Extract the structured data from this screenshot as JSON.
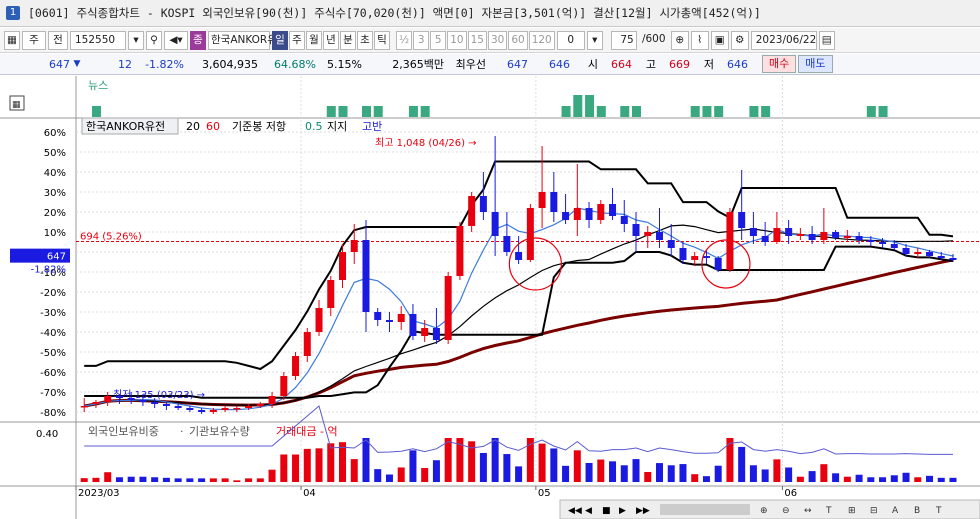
{
  "window": {
    "title": "[0601] 주식종합차트 - KOSPI 외국인보유[90(천)] 주식수[70,020(천)] 액면[0] 자본금[3,501(억)] 결산[12월] 시가총액[452(억)]",
    "icon": "1"
  },
  "toolbar": {
    "period_select": "주",
    "chart_type": "전",
    "code": "152550",
    "stock_name": "한국ANKOR유",
    "mode_badge": "종",
    "period_tabs": [
      "일",
      "주",
      "월",
      "년",
      "분",
      "초",
      "틱"
    ],
    "period_selected": "일",
    "intervals": [
      "½",
      "3",
      "5",
      "10",
      "15",
      "30",
      "60",
      "120"
    ],
    "interval_value": "0",
    "view_count": "75",
    "view_total": "/600",
    "date": "2023/06/22"
  },
  "quote": {
    "price": "647",
    "change": "12",
    "change_pct": "-1.82%",
    "volume": "3,604,935",
    "vol_ratio": "64.68%",
    "turnover": "5.15%",
    "amount": "2,365백만",
    "priority_label": "최우선",
    "bid": "647",
    "ask": "646",
    "open_label": "시",
    "open": "664",
    "high_label": "고",
    "high": "669",
    "low_label": "저",
    "low": "646",
    "buy_button": "매수",
    "sell_button": "매도"
  },
  "news_panel": {
    "label": "뉴스",
    "bars": [
      0,
      1,
      0,
      0,
      0,
      0,
      0,
      0,
      0,
      0,
      0,
      0,
      0,
      0,
      0,
      0,
      0,
      0,
      0,
      0,
      0,
      1,
      1,
      0,
      1,
      1,
      0,
      0,
      1,
      1,
      0,
      0,
      0,
      0,
      0,
      0,
      0,
      0,
      0,
      0,
      0,
      1,
      2,
      2,
      1,
      0,
      1,
      1,
      0,
      0,
      0,
      0,
      1,
      1,
      1,
      0,
      0,
      1,
      1,
      0,
      0,
      0,
      0,
      0,
      0,
      0,
      0,
      1,
      1,
      0,
      0,
      0,
      0,
      0,
      0
    ]
  },
  "main_legend": {
    "name": "한국ANKOR유전",
    "ma1": "20",
    "ma2": "60",
    "ind_label": "기준봉 저항",
    "ind_val": "0.5",
    "support": "지지",
    "resistance": "고반"
  },
  "axis_y": [
    "60%",
    "50%",
    "40%",
    "30%",
    "20%",
    "10%",
    "0%",
    "-10%",
    "-20%",
    "-30%",
    "-40%",
    "-50%",
    "-60%",
    "-70%",
    "-80%"
  ],
  "price_tag": {
    "price": "647",
    "pct": "-1.82%"
  },
  "ref_line": {
    "label": "694 (5.26%)",
    "value": 5.26
  },
  "annotations": {
    "high": "최고 1,048 (04/26)",
    "low": "최저 135 (03/23)"
  },
  "chart_data": {
    "type": "candlestick",
    "y_unit": "%",
    "ylim": [
      -82,
      66
    ],
    "candles": [
      {
        "o": -77,
        "h": -73,
        "l": -80,
        "c": -77
      },
      {
        "o": -76,
        "h": -74,
        "l": -78,
        "c": -75
      },
      {
        "o": -75,
        "h": -70,
        "l": -77,
        "c": -72
      },
      {
        "o": -72,
        "h": -71,
        "l": -76,
        "c": -73
      },
      {
        "o": -73,
        "h": -70,
        "l": -76,
        "c": -74
      },
      {
        "o": -74,
        "h": -71,
        "l": -77,
        "c": -75
      },
      {
        "o": -75,
        "h": -73,
        "l": -78,
        "c": -76
      },
      {
        "o": -76,
        "h": -75,
        "l": -79,
        "c": -77
      },
      {
        "o": -77,
        "h": -76,
        "l": -79,
        "c": -78
      },
      {
        "o": -78,
        "h": -77,
        "l": -80,
        "c": -79
      },
      {
        "o": -79,
        "h": -78,
        "l": -81,
        "c": -80
      },
      {
        "o": -80,
        "h": -78,
        "l": -81,
        "c": -79
      },
      {
        "o": -79,
        "h": -77,
        "l": -80,
        "c": -78
      },
      {
        "o": -78,
        "h": -77,
        "l": -80,
        "c": -78
      },
      {
        "o": -78,
        "h": -76,
        "l": -79,
        "c": -77
      },
      {
        "o": -77,
        "h": -75,
        "l": -78,
        "c": -76
      },
      {
        "o": -76,
        "h": -70,
        "l": -78,
        "c": -72
      },
      {
        "o": -72,
        "h": -60,
        "l": -74,
        "c": -62
      },
      {
        "o": -62,
        "h": -50,
        "l": -64,
        "c": -52
      },
      {
        "o": -52,
        "h": -38,
        "l": -55,
        "c": -40
      },
      {
        "o": -40,
        "h": -24,
        "l": -42,
        "c": -28
      },
      {
        "o": -28,
        "h": -12,
        "l": -32,
        "c": -14
      },
      {
        "o": -14,
        "h": 4,
        "l": -18,
        "c": 0
      },
      {
        "o": 0,
        "h": 14,
        "l": -6,
        "c": 6
      },
      {
        "o": 6,
        "h": 16,
        "l": -40,
        "c": -30
      },
      {
        "o": -30,
        "h": -28,
        "l": -37,
        "c": -34
      },
      {
        "o": -34,
        "h": -30,
        "l": -40,
        "c": -35
      },
      {
        "o": -35,
        "h": -27,
        "l": -39,
        "c": -31
      },
      {
        "o": -31,
        "h": -26,
        "l": -44,
        "c": -42
      },
      {
        "o": -42,
        "h": -34,
        "l": -45,
        "c": -38
      },
      {
        "o": -38,
        "h": -28,
        "l": -46,
        "c": -44
      },
      {
        "o": -44,
        "h": -10,
        "l": -46,
        "c": -12
      },
      {
        "o": -12,
        "h": 15,
        "l": -14,
        "c": 13
      },
      {
        "o": 13,
        "h": 30,
        "l": 10,
        "c": 28
      },
      {
        "o": 28,
        "h": 40,
        "l": 16,
        "c": 20
      },
      {
        "o": 20,
        "h": 58,
        "l": -2,
        "c": 8
      },
      {
        "o": 8,
        "h": 20,
        "l": -2,
        "c": 0
      },
      {
        "o": 0,
        "h": 8,
        "l": -6,
        "c": -4
      },
      {
        "o": -4,
        "h": 24,
        "l": -5,
        "c": 22
      },
      {
        "o": 22,
        "h": 53,
        "l": 12,
        "c": 30
      },
      {
        "o": 30,
        "h": 40,
        "l": 15,
        "c": 20
      },
      {
        "o": 20,
        "h": 29,
        "l": 14,
        "c": 16
      },
      {
        "o": 16,
        "h": 44,
        "l": 8,
        "c": 22
      },
      {
        "o": 22,
        "h": 25,
        "l": 12,
        "c": 16
      },
      {
        "o": 16,
        "h": 26,
        "l": 14,
        "c": 24
      },
      {
        "o": 24,
        "h": 32,
        "l": 16,
        "c": 18
      },
      {
        "o": 18,
        "h": 26,
        "l": 10,
        "c": 14
      },
      {
        "o": 14,
        "h": 20,
        "l": 0,
        "c": 8
      },
      {
        "o": 8,
        "h": 13,
        "l": 2,
        "c": 10
      },
      {
        "o": 10,
        "h": 22,
        "l": 2,
        "c": 6
      },
      {
        "o": 6,
        "h": 14,
        "l": -2,
        "c": 2
      },
      {
        "o": 2,
        "h": 5,
        "l": -6,
        "c": -4
      },
      {
        "o": -4,
        "h": 0,
        "l": -7,
        "c": -2
      },
      {
        "o": -2,
        "h": 1,
        "l": -6,
        "c": -3
      },
      {
        "o": -3,
        "h": -2,
        "l": -10,
        "c": -9
      },
      {
        "o": -9,
        "h": 22,
        "l": -10,
        "c": 20
      },
      {
        "o": 20,
        "h": 41,
        "l": 6,
        "c": 12
      },
      {
        "o": 12,
        "h": 20,
        "l": 4,
        "c": 8
      },
      {
        "o": 8,
        "h": 15,
        "l": 3,
        "c": 5
      },
      {
        "o": 5,
        "h": 20,
        "l": 4,
        "c": 12
      },
      {
        "o": 12,
        "h": 16,
        "l": 4,
        "c": 8
      },
      {
        "o": 8,
        "h": 12,
        "l": 6,
        "c": 9
      },
      {
        "o": 9,
        "h": 13,
        "l": 4,
        "c": 6
      },
      {
        "o": 6,
        "h": 22,
        "l": 4,
        "c": 10
      },
      {
        "o": 10,
        "h": 11,
        "l": 6,
        "c": 7
      },
      {
        "o": 7,
        "h": 11,
        "l": 5,
        "c": 8
      },
      {
        "o": 8,
        "h": 10,
        "l": 4,
        "c": 6
      },
      {
        "o": 6,
        "h": 8,
        "l": 3,
        "c": 5
      },
      {
        "o": 5,
        "h": 7,
        "l": 2,
        "c": 4
      },
      {
        "o": 4,
        "h": 6,
        "l": 1,
        "c": 2
      },
      {
        "o": 2,
        "h": 4,
        "l": -2,
        "c": -1
      },
      {
        "o": -1,
        "h": 2,
        "l": -3,
        "c": 0
      },
      {
        "o": 0,
        "h": 1,
        "l": -3,
        "c": -2
      },
      {
        "o": -2,
        "h": 0,
        "l": -4,
        "c": -3
      },
      {
        "o": -3,
        "h": -1,
        "l": -5,
        "c": -4
      }
    ]
  },
  "volume_panel": {
    "label1": "외국인보유비중",
    "sep": "·",
    "label2": "기관보유수량",
    "label3": "거래대금 - 억",
    "axis_label": "0.40"
  },
  "x_labels": [
    "2023/03",
    "04",
    "05",
    "06"
  ],
  "colors": {
    "up": "#e8000e",
    "down": "#1a1ae0",
    "ma_dark": "#7a0000",
    "grid": "#dcdcdc"
  }
}
